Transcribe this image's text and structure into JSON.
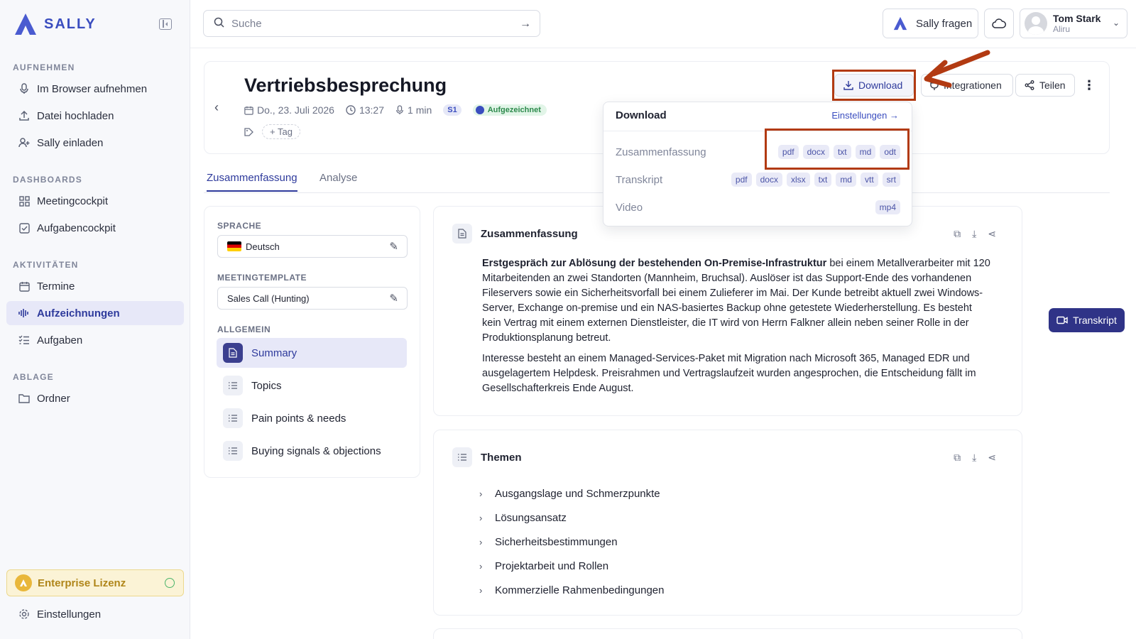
{
  "brand": {
    "name": "SALLY",
    "accent": "#3a4dbf"
  },
  "sidebar": {
    "sections": [
      {
        "label": "AUFNEHMEN",
        "items": [
          {
            "label": "Im Browser aufnehmen",
            "icon": "microphone-icon"
          },
          {
            "label": "Datei hochladen",
            "icon": "upload-icon"
          },
          {
            "label": "Sally einladen",
            "icon": "user-plus-icon"
          }
        ]
      },
      {
        "label": "DASHBOARDS",
        "items": [
          {
            "label": "Meetingcockpit",
            "icon": "grid-icon"
          },
          {
            "label": "Aufgabencockpit",
            "icon": "checkbox-icon"
          }
        ]
      },
      {
        "label": "AKTIVITÄTEN",
        "items": [
          {
            "label": "Termine",
            "icon": "calendar-icon"
          },
          {
            "label": "Aufzeichnungen",
            "icon": "waveform-icon",
            "active": true
          },
          {
            "label": "Aufgaben",
            "icon": "checklist-icon"
          }
        ]
      },
      {
        "label": "ABLAGE",
        "items": [
          {
            "label": "Ordner",
            "icon": "folder-icon"
          }
        ]
      }
    ],
    "license": "Enterprise Lizenz",
    "settings": "Einstellungen"
  },
  "topbar": {
    "search_placeholder": "Suche",
    "ask_label": "Sally fragen",
    "user_name": "Tom Stark",
    "user_org": "Aliru"
  },
  "meeting": {
    "title": "Vertriebsbesprechung",
    "date": "Do., 23. Juli 2026",
    "time": "13:27",
    "duration": "1 min",
    "speaker_badge": "S1",
    "status": "Aufgezeichnet",
    "tag_button": "Tag",
    "actions": {
      "download": "Download",
      "integrations": "Integrationen",
      "share": "Teilen"
    }
  },
  "download_menu": {
    "title": "Download",
    "settings_link": "Einstellungen",
    "rows": [
      {
        "label": "Zusammenfassung",
        "formats": [
          "pdf",
          "docx",
          "txt",
          "md",
          "odt"
        ]
      },
      {
        "label": "Transkript",
        "formats": [
          "pdf",
          "docx",
          "xlsx",
          "txt",
          "md",
          "vtt",
          "srt"
        ]
      },
      {
        "label": "Video",
        "formats": [
          "mp4"
        ]
      }
    ]
  },
  "tabs": {
    "summary": "Zusammenfassung",
    "analysis": "Analyse"
  },
  "settings_panel": {
    "language_label": "SPRACHE",
    "language_value": "Deutsch",
    "template_label": "MEETINGTEMPLATE",
    "template_value": "Sales Call (Hunting)",
    "general_label": "ALLGEMEIN",
    "items": [
      "Summary",
      "Topics",
      "Pain points & needs",
      "Buying signals & objections"
    ]
  },
  "summary_card": {
    "title": "Zusammenfassung",
    "para1_bold": "Erstgespräch zur Ablösung der bestehenden On-Premise-Infrastruktur",
    "para1_rest": " bei einem Metallverarbeiter mit 120 Mitarbeitenden an zwei Standorten (Mannheim, Bruchsal). Auslöser ist das Support-Ende des vorhandenen Fileservers sowie ein Sicherheitsvorfall bei einem Zulieferer im Mai. Der Kunde betreibt aktuell zwei Windows-Server, Exchange on-premise und ein NAS-basiertes Backup ohne getestete Wiederherstellung. Es besteht kein Vertrag mit einem externen Dienstleister, die IT wird von Herrn Falkner allein neben seiner Rolle in der Produktionsplanung betreut.",
    "para2": "Interesse besteht an einem Managed-Services-Paket mit Migration nach Microsoft 365, Managed EDR und ausgelagertem Helpdesk. Preisrahmen und Vertragslaufzeit wurden angesprochen, die Entscheidung fällt im Gesellschafterkreis Ende August."
  },
  "topics_card": {
    "title": "Themen",
    "items": [
      "Ausgangslage und Schmerzpunkte",
      "Lösungsansatz",
      "Sicherheitsbestimmungen",
      "Projektarbeit und Rollen",
      "Kommerzielle Rahmenbedingungen"
    ]
  },
  "transcript_button": "Transkript"
}
